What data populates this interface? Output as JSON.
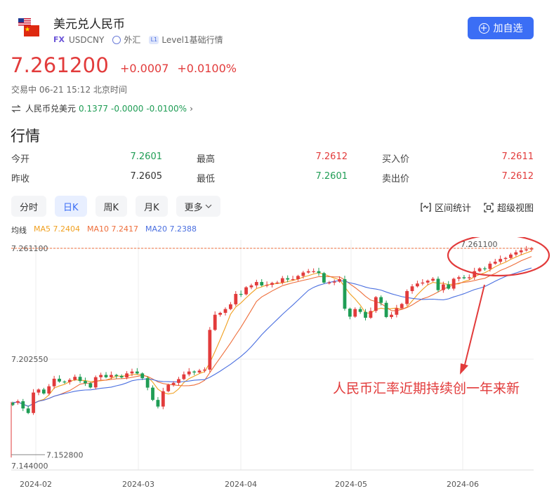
{
  "header": {
    "title": "美元兑人民币",
    "tag_fx": "FX",
    "code": "USDCNY",
    "market": "外汇",
    "level_tag": "L1",
    "level": "Level1基础行情",
    "add_label": "加自选"
  },
  "quote": {
    "price": "7.261200",
    "change": "+0.0007",
    "change_pct": "+0.0100%",
    "trade_time": "交易中 06-21 15:12 北京时间",
    "reverse_label": "人民币兑美元",
    "reverse_price": "0.1377",
    "reverse_change": "-0.0000",
    "reverse_change_pct": "-0.0100%"
  },
  "section_title": "行情",
  "stats": [
    {
      "label": "今开",
      "value": "7.2601",
      "color": "green"
    },
    {
      "label": "最高",
      "value": "7.2612",
      "color": "red"
    },
    {
      "label": "买入价",
      "value": "7.2611",
      "color": "red"
    },
    {
      "label": "昨收",
      "value": "7.2605",
      "color": "plain"
    },
    {
      "label": "最低",
      "value": "7.2601",
      "color": "green"
    },
    {
      "label": "卖出价",
      "value": "7.2612",
      "color": "red"
    }
  ],
  "tabs": [
    {
      "label": "分时",
      "active": false
    },
    {
      "label": "日K",
      "active": true
    },
    {
      "label": "周K",
      "active": false
    },
    {
      "label": "月K",
      "active": false
    },
    {
      "label": "更多",
      "active": false
    }
  ],
  "tools": {
    "range_stats": "区间统计",
    "super_view": "超级视图"
  },
  "ma": {
    "label": "均线",
    "ma5": "MA5 7.2404",
    "ma10": "MA10 7.2417",
    "ma20": "MA20 7.2388"
  },
  "colors": {
    "up": "#e23b3b",
    "down": "#1f9d55",
    "ma5": "#f0a020",
    "ma10": "#ee6e3b",
    "ma20": "#4a6fe0",
    "accent": "#3b6ef5"
  },
  "chart_data": {
    "type": "candlestick",
    "y_axis_labels": [
      "7.261100",
      "7.202550",
      "7.144000"
    ],
    "ylim": [
      7.144,
      7.2611
    ],
    "x_axis_labels": [
      "2024-02",
      "2024-03",
      "2024-04",
      "2024-05",
      "2024-06"
    ],
    "last_price_line": "7.261100",
    "low_marker": "7.152800",
    "annotation": "人民币汇率近期持续创一年来新",
    "closes": [
      7.1795,
      7.1803,
      7.1765,
      7.1741,
      7.1849,
      7.1865,
      7.1844,
      7.1882,
      7.1922,
      7.1907,
      7.1905,
      7.1916,
      7.1932,
      7.191,
      7.1898,
      7.1876,
      7.193,
      7.1942,
      7.193,
      7.1942,
      7.1936,
      7.1929,
      7.195,
      7.196,
      7.195,
      7.1925,
      7.1875,
      7.181,
      7.1775,
      7.1856,
      7.189,
      7.19,
      7.192,
      7.1945,
      7.196,
      7.1955,
      7.1965,
      7.197,
      7.218,
      7.226,
      7.227,
      7.229,
      7.2315,
      7.237,
      7.2368,
      7.2405,
      7.2415,
      7.2433,
      7.2415,
      7.2418,
      7.2428,
      7.243,
      7.2453,
      7.2446,
      7.2448,
      7.2465,
      7.2483,
      7.249,
      7.249,
      7.248,
      7.243,
      7.243,
      7.2435,
      7.2448,
      7.2292,
      7.225,
      7.229,
      7.2275,
      7.2244,
      7.228,
      7.2353,
      7.2323,
      7.2248,
      7.226,
      7.2294,
      7.2317,
      7.2385,
      7.241,
      7.2425,
      7.243,
      7.244,
      7.245,
      7.239,
      7.242,
      7.2398,
      7.245,
      7.2458,
      7.2453,
      7.2458,
      7.249,
      7.2505,
      7.2502,
      7.253,
      7.254,
      7.2555,
      7.256,
      7.2578,
      7.259,
      7.26,
      7.2605,
      7.2612
    ],
    "bullish": [
      false,
      true,
      false,
      false,
      true,
      true,
      false,
      true,
      true,
      false,
      false,
      true,
      true,
      false,
      false,
      false,
      true,
      true,
      false,
      true,
      false,
      false,
      true,
      true,
      false,
      false,
      false,
      false,
      false,
      true,
      true,
      true,
      true,
      true,
      true,
      false,
      true,
      true,
      true,
      true,
      true,
      true,
      true,
      true,
      false,
      true,
      true,
      true,
      false,
      true,
      true,
      true,
      true,
      false,
      true,
      true,
      true,
      true,
      true,
      false,
      false,
      true,
      true,
      true,
      false,
      false,
      true,
      false,
      false,
      true,
      true,
      false,
      false,
      true,
      true,
      true,
      true,
      true,
      true,
      true,
      true,
      true,
      false,
      true,
      false,
      true,
      true,
      false,
      true,
      true,
      true,
      false,
      true,
      true,
      true,
      true,
      true,
      true,
      true,
      true,
      true
    ]
  }
}
